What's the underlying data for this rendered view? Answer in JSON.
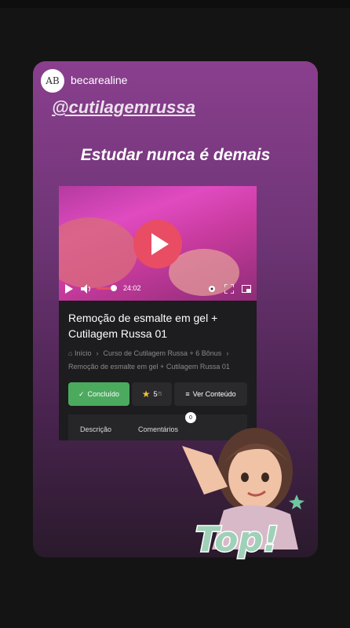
{
  "story": {
    "avatar_initials": "AB",
    "username": "becarealine",
    "mention": "@cutilagemrussa",
    "headline": "Estudar nunca é demais"
  },
  "player": {
    "time": "24:02",
    "progress_fraction": 0.1
  },
  "lesson": {
    "title": "Remoção de esmalte em gel + Cutilagem Russa 01",
    "breadcrumb": {
      "home": "Início",
      "course": "Curso de Cutilagem Russa + 6 Bônus",
      "current": "Remoção de esmalte em gel + Cutilagem Russa 01"
    },
    "buttons": {
      "done_label": "Concluído",
      "rating_value": "5",
      "rating_total": "/5",
      "view_label": "Ver Conteúdo"
    },
    "tabs": {
      "description": "Descrição",
      "comments": "Comentários",
      "comments_count": "0"
    }
  },
  "sticker": {
    "text": "Top!"
  },
  "colors": {
    "accent": "#e94d63",
    "done_green": "#4caa5f",
    "story_purple": "#7a3a80"
  }
}
